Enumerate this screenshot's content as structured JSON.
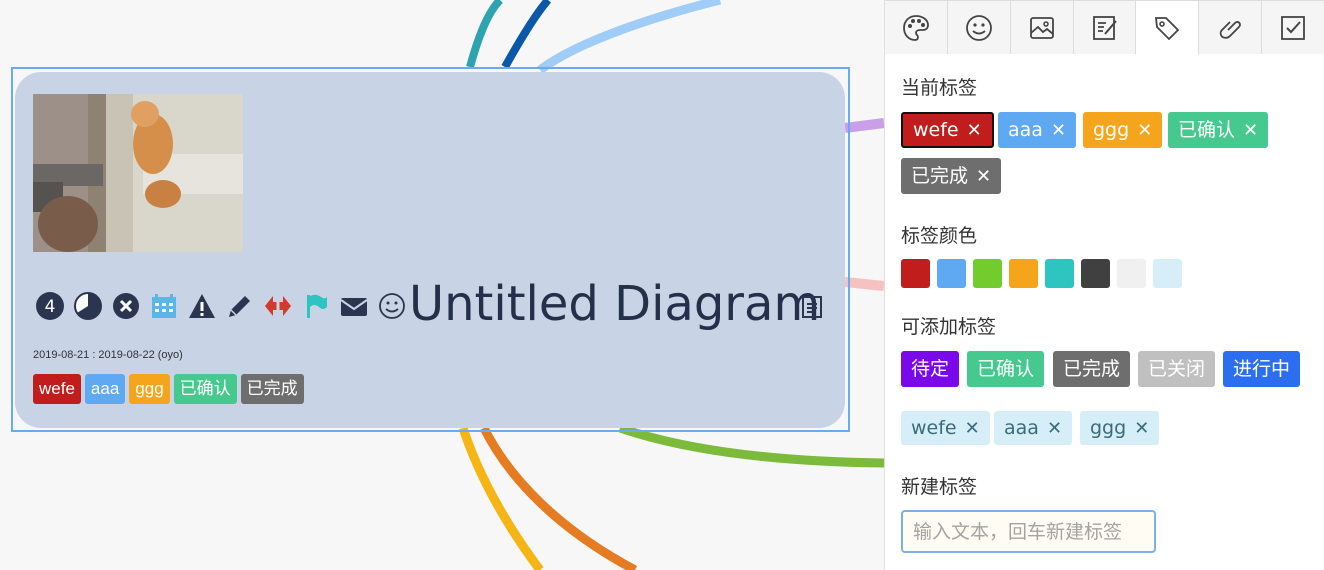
{
  "node": {
    "title": "Untitled Diagram",
    "date": "2019-08-21 : 2019-08-22  (oyo)",
    "priority": "4",
    "icons": [
      "priority-4-icon",
      "progress-icon",
      "close-circle-icon",
      "calendar-icon",
      "warning-icon",
      "pencil-icon",
      "arrows-icon",
      "flag-icon",
      "mail-icon",
      "smiley-icon"
    ],
    "tags": [
      {
        "label": "wefe",
        "color": "#c21d1d"
      },
      {
        "label": "aaa",
        "color": "#5fa8f2"
      },
      {
        "label": "ggg",
        "color": "#f5a51b"
      },
      {
        "label": "已确认",
        "color": "#45c98f"
      },
      {
        "label": "已完成",
        "color": "#6e6e6e"
      }
    ]
  },
  "panel": {
    "tabs": [
      "palette-icon",
      "smiley-icon",
      "image-icon",
      "note-icon",
      "tag-icon",
      "link-icon",
      "checkbox-icon"
    ],
    "active_tab": 4,
    "current_title": "当前标签",
    "current_tags": [
      {
        "label": "wefe",
        "color": "#c21d1d",
        "selected": true
      },
      {
        "label": "aaa",
        "color": "#5fa8f2"
      },
      {
        "label": "ggg",
        "color": "#f5a51b"
      },
      {
        "label": "已确认",
        "color": "#45c98f"
      },
      {
        "label": "已完成",
        "color": "#6e6e6e"
      }
    ],
    "color_title": "标签颜色",
    "colors": [
      "#c21d1d",
      "#5fa8f2",
      "#72cc2e",
      "#f5a51b",
      "#2ec4c0",
      "#404040",
      "#f0f0f0",
      "#d6eef7"
    ],
    "addable_title": "可添加标签",
    "addable_tags": [
      {
        "label": "待定",
        "color": "#7b08e8"
      },
      {
        "label": "已确认",
        "color": "#45c98f"
      },
      {
        "label": "已完成",
        "color": "#6e6e6e"
      },
      {
        "label": "已关闭",
        "color": "#c0c0c0"
      },
      {
        "label": "进行中",
        "color": "#2b6ff0"
      }
    ],
    "custom_tags": [
      "wefe",
      "aaa",
      "ggg"
    ],
    "new_title": "新建标签",
    "new_placeholder": "输入文本，回车新建标签"
  }
}
